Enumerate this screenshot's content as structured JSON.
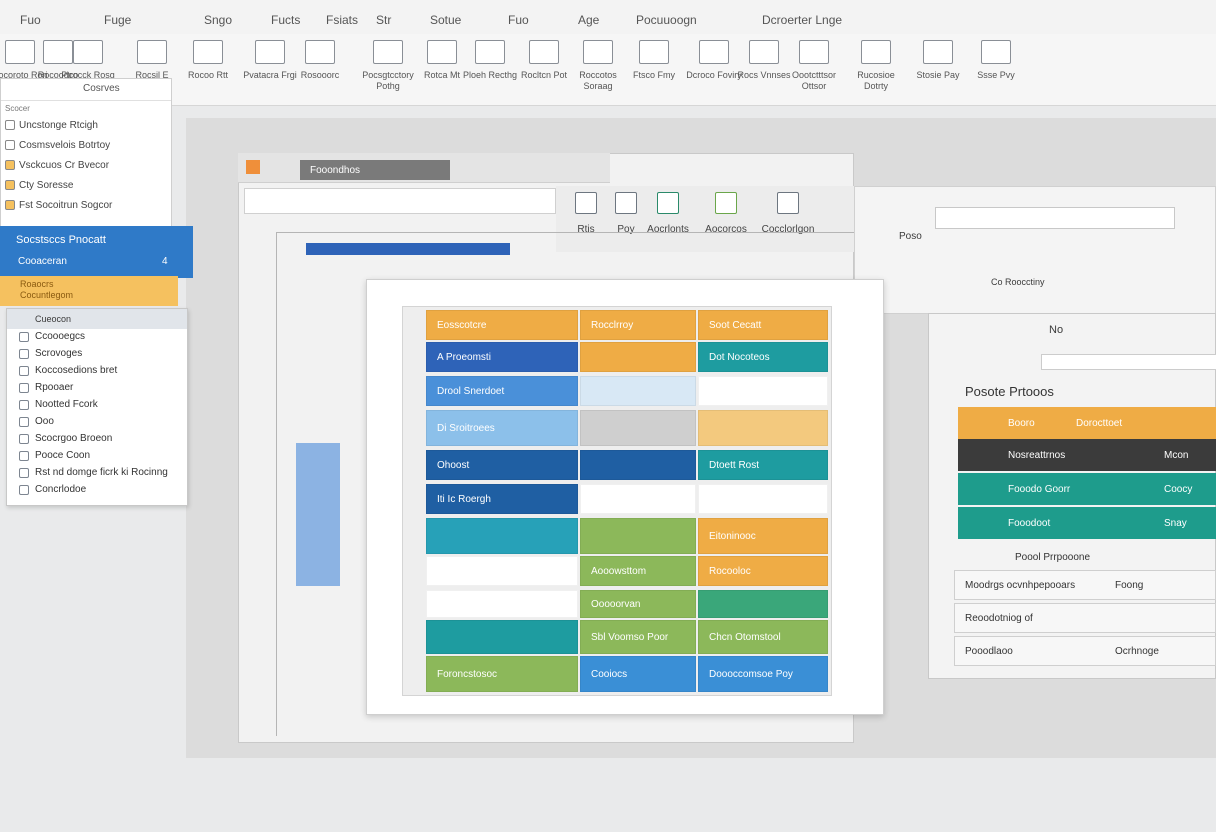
{
  "menu": [
    "Fuo",
    "Fuge",
    "Sngo",
    "Fucts",
    "Fsiats",
    "Str",
    "Sotue",
    "Fuo",
    "Age",
    "Pocuuoogn",
    "Dcroerter Lnge"
  ],
  "ribbon": [
    {
      "label": "Socoroto Rori",
      "icon": "window-icon"
    },
    {
      "label": "Rocoodco Vocarore",
      "icon": "document-icon"
    },
    {
      "label": "Ptrocck Rosg",
      "icon": "table-icon"
    },
    {
      "label": "Rocsil E",
      "icon": "grid-icon"
    },
    {
      "label": "Rocoo Rtt",
      "icon": "list-icon"
    },
    {
      "label": "Pvatacra Frgi",
      "icon": "chart-icon"
    },
    {
      "label": "Rosooorc",
      "icon": "table-icon"
    },
    {
      "label": "Pocsgtcctory Pothg",
      "icon": "monitor-icon"
    },
    {
      "label": "Rotca Mt",
      "icon": "window-icon"
    },
    {
      "label": "Ploeh Recthg",
      "icon": "document-icon"
    },
    {
      "label": "Rocltcn Pot",
      "icon": "list-icon"
    },
    {
      "label": "Roccotos Soraag",
      "icon": "chart-icon"
    },
    {
      "label": "Ftsco Fmy",
      "icon": "image-icon"
    },
    {
      "label": "Dcroco Foviry",
      "icon": "document-icon"
    },
    {
      "label": "Rocs Vnnses",
      "icon": "window-icon"
    },
    {
      "label": "Oootctttsor Ottsor",
      "icon": "grid-icon"
    },
    {
      "label": "Rucosioe Dotrty",
      "icon": "table-icon"
    },
    {
      "label": "Stosie Pay",
      "icon": "list-icon"
    },
    {
      "label": "Ssse Pvy",
      "icon": "document-icon"
    }
  ],
  "left_panel": {
    "header": "Cosrves",
    "section": "Scocer",
    "items": [
      "Uncstonge Rtcigh",
      "Cosmsvelois Botrtoy",
      "Vsckcuos Cr Bvecor",
      "Cty Soresse",
      "Fst Socoitrun Sogcor"
    ]
  },
  "blue_panel": {
    "title": "Socstsccs Pnocatt",
    "sub": "Cooaceran",
    "badge": "4"
  },
  "orange_item": {
    "line1": "Roaocrs",
    "line2": "Cocuntlegom"
  },
  "dropdown": {
    "header": "Cueocon",
    "items": [
      "Ccoooegcs",
      "Scrovoges",
      "Koccosedions bret",
      "Rpooaer",
      "Nootted Fcork",
      "Ooo",
      "Scocrgoo Broeon",
      "Pooce Coon",
      "Rst nd domge ficrk ki Rocinng",
      "Concrlodoe"
    ]
  },
  "window": {
    "title": "Fooondhos",
    "toolbar": [
      "Rtis",
      "Poy",
      "Aocrlonts",
      "Aocorcos",
      "Cocclorlgon"
    ]
  },
  "grid": {
    "rows": [
      [
        "Eosscotcre",
        "Rocclrroy",
        "Soot Cecatt"
      ],
      [
        "A Proeomsti",
        "",
        "Dot Nocoteos"
      ],
      [
        "Drool Snerdoet",
        "",
        ""
      ],
      [
        "Di Sroitroees",
        "",
        ""
      ],
      [
        "Ohoost",
        "",
        "Dtoett Rost"
      ],
      [
        "Iti Ic Roergh",
        "",
        ""
      ],
      [
        "",
        "",
        "Eitoninooc"
      ],
      [
        "",
        "Aooowsttom",
        "Rocooloc"
      ],
      [
        "",
        "Ooooorvan",
        ""
      ],
      [
        "",
        "Sbl Voomso Poor",
        "Chcn Otomstool"
      ],
      [
        "Foroncstosoc",
        "Cooiocs",
        "Doooccomsoe Poy"
      ]
    ]
  },
  "side_window": {
    "top": "No",
    "title": "Posote Prtooos",
    "rows": [
      {
        "a": "Booro",
        "b": "Dorocttoet",
        "c": ""
      },
      {
        "a": "Nosreattrnos",
        "b": "",
        "c": "Mcon"
      },
      {
        "a": "Fooodo Goorr",
        "b": "",
        "c": "Coocy"
      },
      {
        "a": "Fooodoot",
        "b": "",
        "c": "Snay"
      }
    ],
    "footer_label": "Poool Prrpooone",
    "form": [
      {
        "label": "Moodrgs ocvnhpepooars",
        "value": "Foong"
      },
      {
        "label": "Reoodotniog of",
        "value": ""
      },
      {
        "label": "Pooodlaoo",
        "value": "Ocrhnoge"
      }
    ]
  },
  "right_panel": {
    "label1": "Poso",
    "label2": "Co Roocctiny"
  },
  "colors": {
    "orange": "#efac45",
    "blue": "#2e63b8",
    "lightblue": "#8cc0ea",
    "teal": "#1e9ca0",
    "green": "#8cb85a",
    "dark": "#3b3b3b"
  }
}
